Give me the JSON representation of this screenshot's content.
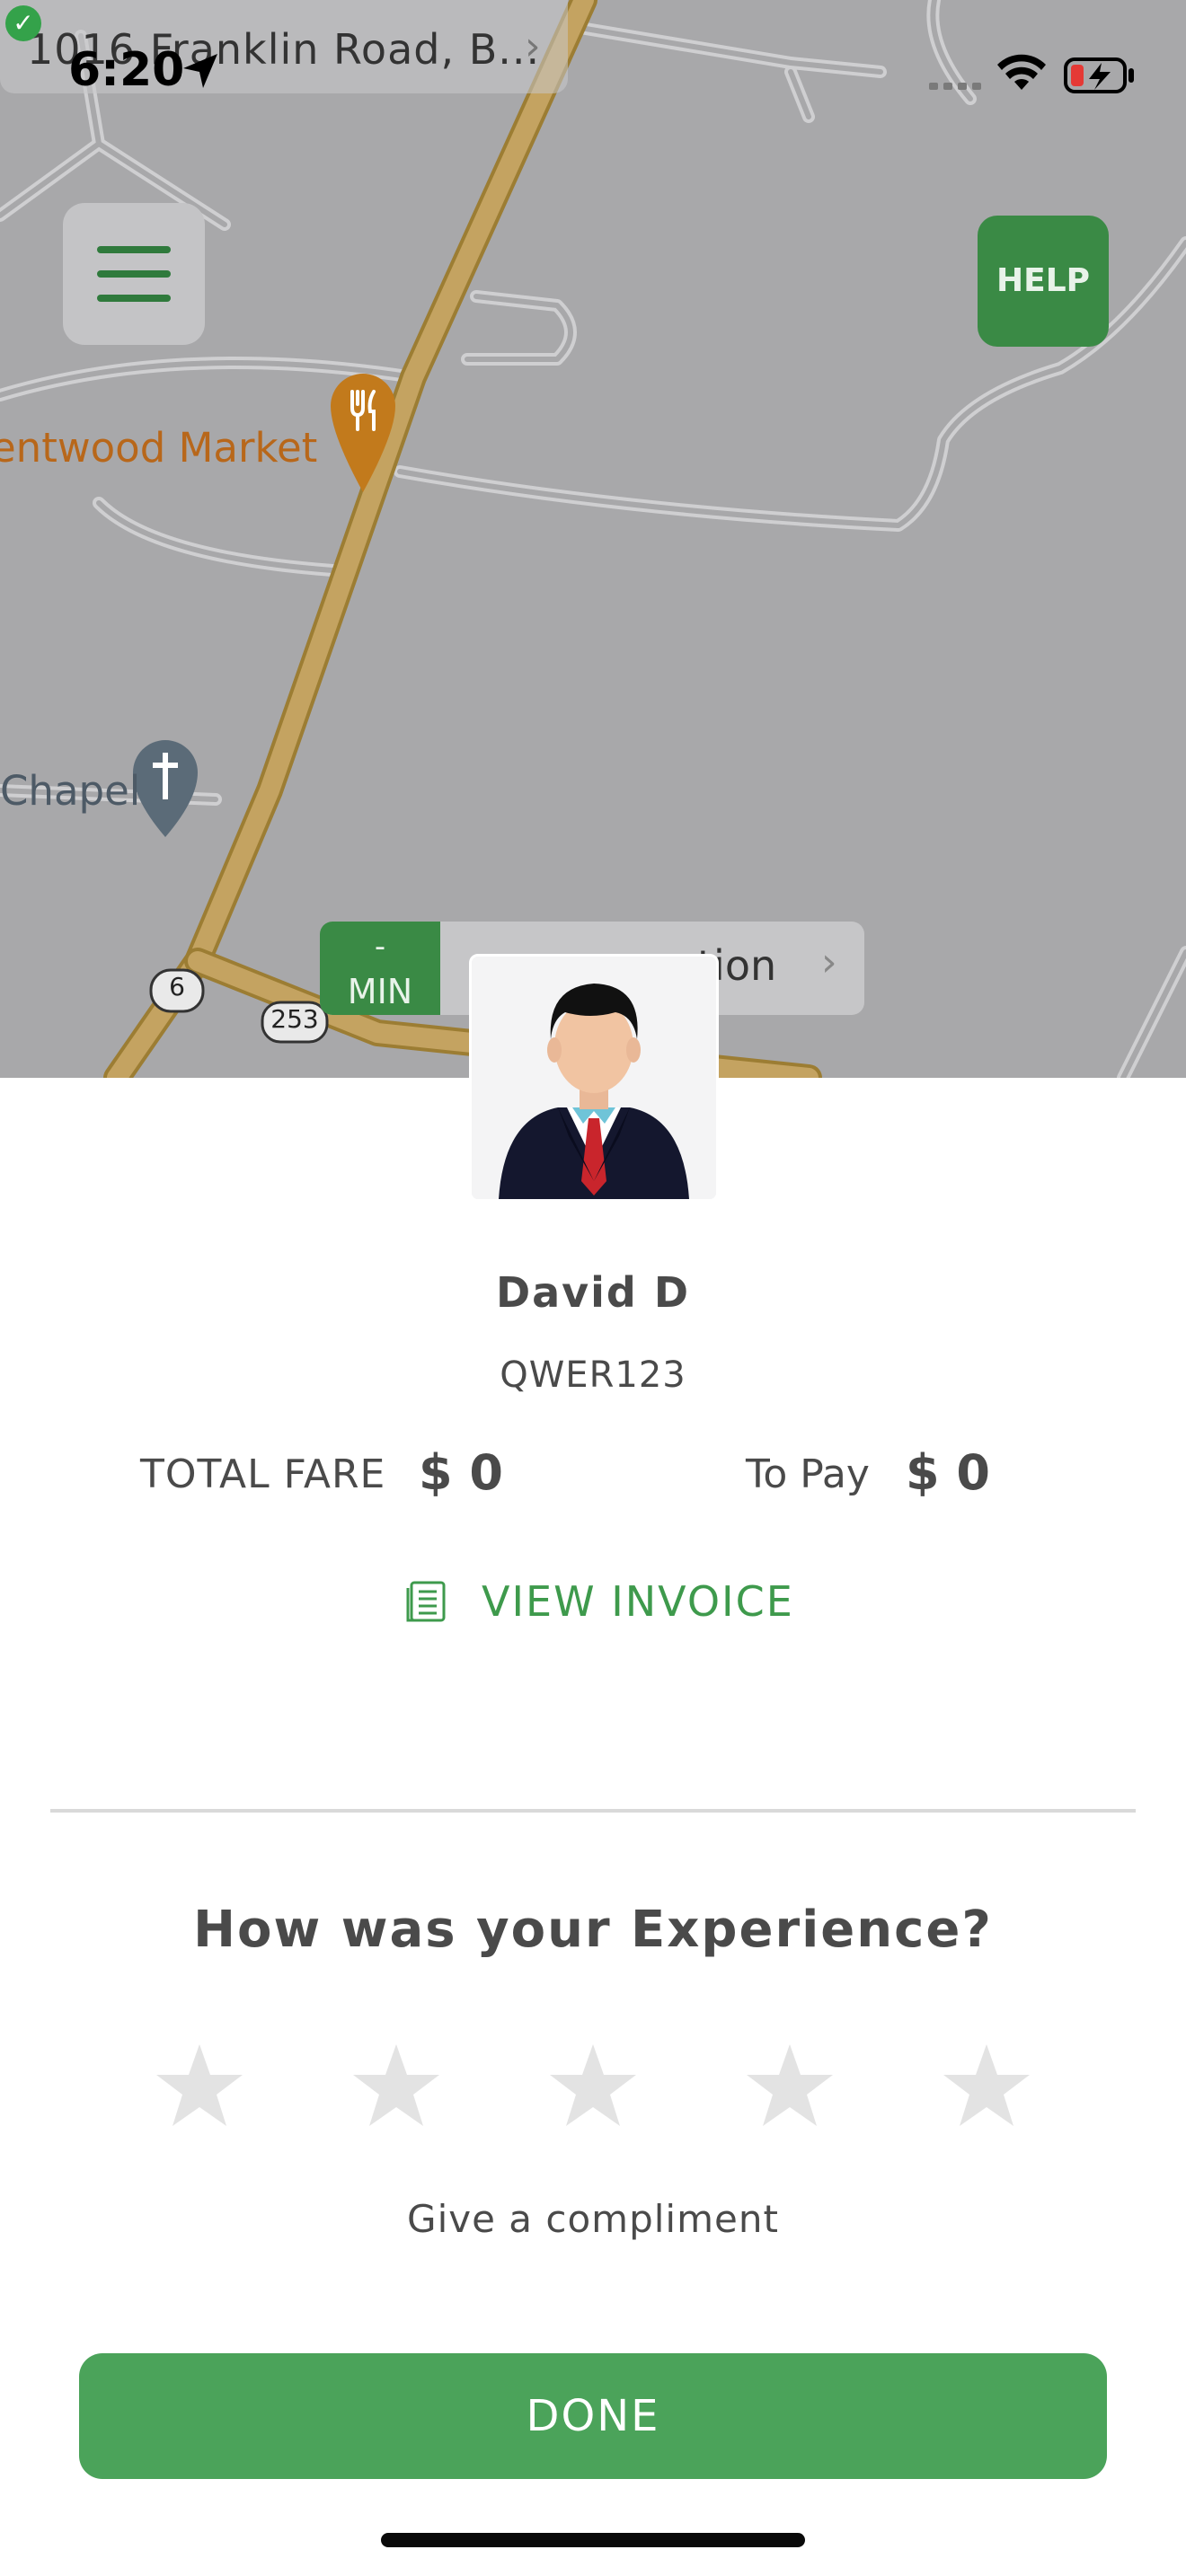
{
  "status_bar": {
    "time": "6:20",
    "back_link": "1016 Franklin Road, B...",
    "back_chevron": "›",
    "check_icon": "✓"
  },
  "map": {
    "poi_market": "entwood Market",
    "poi_chapel": "Chapel",
    "route_6": "6",
    "route_253": "253"
  },
  "menu": {
    "icon": "hamburger-icon"
  },
  "help": {
    "label": "HELP"
  },
  "eta": {
    "min_value": "-",
    "min_unit": "MIN",
    "destination": "tion",
    "chevron": "›"
  },
  "driver": {
    "name": "David D",
    "plate": "QWER123"
  },
  "fare": {
    "total_label": "TOTAL FARE",
    "total_value": "$ 0",
    "to_pay_label": "To Pay",
    "to_pay_value": "$ 0"
  },
  "invoice": {
    "label": "VIEW INVOICE",
    "icon": "invoice-icon"
  },
  "rating": {
    "question": "How was your Experience?",
    "stars_total": 5,
    "stars_selected": 0,
    "compliment": "Give a compliment"
  },
  "done": {
    "label": "DONE"
  },
  "colors": {
    "brand_green": "#4ba35a",
    "dark_green": "#3a8a45",
    "star_gray": "#e3e3e3"
  }
}
